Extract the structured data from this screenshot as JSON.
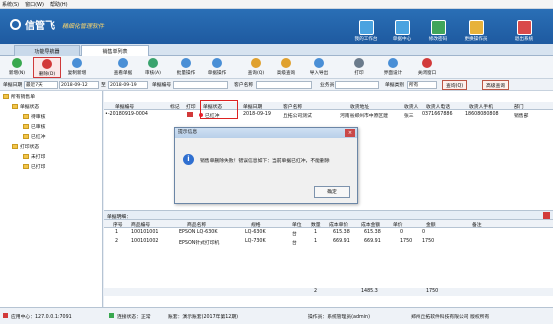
{
  "menu": [
    "系统(S)",
    "窗口(W)",
    "帮助(H)"
  ],
  "brand": {
    "name": "信管飞",
    "tagline": "精细化管理软件"
  },
  "topnav": [
    {
      "label": "我的工作台",
      "color": "#4aa3e0"
    },
    {
      "label": "单据中心",
      "color": "#4aa3e0"
    },
    {
      "label": "修改密码",
      "color": "#41a55a"
    },
    {
      "label": "更换操作员",
      "color": "#e7b23b"
    },
    {
      "label": "退出系统",
      "color": "#d94a4a"
    }
  ],
  "tabs": {
    "home": "功能导航器",
    "current": "销售单列表"
  },
  "toolbar": {
    "new": "新增(N)",
    "delete": "删除(D)",
    "copy": "复制新增",
    "view": "查看单据",
    "audit": "审核(A)",
    "batch": "批量操作",
    "ops": "单据操作",
    "query": "查询(Q)",
    "advanced": "高级查询",
    "import": "导入导出",
    "print": "打印",
    "layout": "界面设计",
    "close": "关闭窗口"
  },
  "filter": {
    "date_label": "单据日期",
    "date_range": "最近7天",
    "date_from": "2018-09-12",
    "to": "至",
    "date_to": "2018-09-19",
    "no_label": "单据编号",
    "customer_label": "客户名称",
    "clerk_label": "业务员",
    "type_label": "单据类别",
    "type_value": "所有",
    "query_btn": "查询(Q)",
    "adv_btn": "高级查询"
  },
  "tree": {
    "root": "所有销售单",
    "status_group": "单据状态",
    "pending": "待审核",
    "audited": "已审核",
    "red": "已红冲",
    "print_group": "打印状态",
    "unprinted": "未打印",
    "printed": "已打印"
  },
  "grid": {
    "headers": [
      "单据编号",
      "标记",
      "打印",
      "单据状态",
      "单据日期",
      "客户名称",
      "收货地址",
      "收货人",
      "收货人电话",
      "收货人手机",
      "部门"
    ],
    "row": [
      "•-20180919-0004",
      "",
      "",
      "已红冲",
      "2018-09-19",
      "丘拓公司测试",
      "河南省郑州市中原区建",
      "张三",
      "0371667886",
      "18608080808",
      "销售部"
    ]
  },
  "dialog": {
    "title": "提示信息",
    "message": "销售单删除失败！错误信息如下：当前单据已红冲，不能删除",
    "ok": "确定"
  },
  "detail": {
    "title": "单据明细：",
    "headers": [
      "序号",
      "商品编号",
      "商品名称",
      "规格",
      "单位",
      "数量",
      "成本单价",
      "成本金额",
      "单价",
      "金额",
      "备注"
    ],
    "rows": [
      [
        "1",
        "100101001",
        "EPSON LQ-630K",
        "LQ-630K",
        "台",
        "1",
        "615.38",
        "615.38",
        "0",
        "0",
        ""
      ],
      [
        "2",
        "100101002",
        "EPSON针式打印机",
        "LQ-730K",
        "台",
        "1",
        "669.91",
        "669.91",
        "1750",
        "1750",
        ""
      ]
    ],
    "totals": {
      "qty": "2",
      "cost": "1485.3",
      "amount": "1750"
    }
  },
  "statusbar": {
    "server": "应用中心：127.0.0.1:7091",
    "conn": "连接状态：正常",
    "account": "账套：演示账套(2017年第12期)",
    "operator": "操作员：系统管理员(admin)",
    "company": "郑州丘拓软件科技有限公司 版权所有"
  }
}
